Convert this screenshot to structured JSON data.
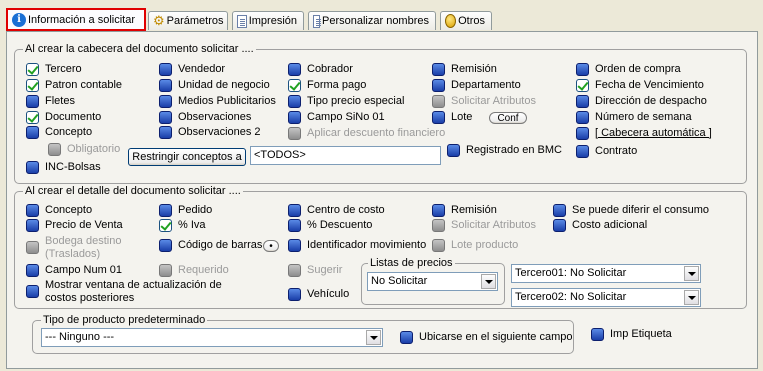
{
  "tabs": [
    {
      "label": "Información a solicitar",
      "icon": "info-icon",
      "active": true
    },
    {
      "label": "Parámetros",
      "icon": "gear-icon"
    },
    {
      "label": "Impresión",
      "icon": "document-icon"
    },
    {
      "label": "Personalizar nombres",
      "icon": "document-icon"
    },
    {
      "label": "Otros",
      "icon": "coin-icon"
    }
  ],
  "header_group": {
    "title": "Al crear la cabecera del documento solicitar ....",
    "items": {
      "tercero": {
        "label": "Tercero",
        "checked": true
      },
      "patron": {
        "label": "Patron contable",
        "checked": true
      },
      "fletes": {
        "label": "Fletes",
        "checked": false
      },
      "documento": {
        "label": "Documento",
        "checked": true
      },
      "concepto": {
        "label": "Concepto",
        "checked": false
      },
      "obligatorio": {
        "label": "Obligatorio",
        "checked": false,
        "disabled": true
      },
      "inc_bolsas": {
        "label": "INC-Bolsas",
        "checked": false
      },
      "vendedor": {
        "label": "Vendedor",
        "checked": false
      },
      "unidad": {
        "label": "Unidad de negocio",
        "checked": false
      },
      "medios": {
        "label": "Medios Publicitarios",
        "checked": false
      },
      "observaciones": {
        "label": "Observaciones",
        "checked": false
      },
      "observaciones2": {
        "label": "Observaciones 2",
        "checked": false
      },
      "cobrador": {
        "label": "Cobrador",
        "checked": false
      },
      "forma_pago": {
        "label": "Forma pago",
        "checked": true
      },
      "tipo_precio": {
        "label": "Tipo precio especial",
        "checked": false
      },
      "campo_sino": {
        "label": "Campo SiNo 01",
        "checked": false
      },
      "aplicar_desc": {
        "label": "Aplicar descuento financiero",
        "checked": false,
        "disabled": true
      },
      "remision": {
        "label": "Remisión",
        "checked": false
      },
      "departamento": {
        "label": "Departamento",
        "checked": false
      },
      "solicitar_atrib": {
        "label": "Solicitar Atributos",
        "checked": false,
        "disabled": true
      },
      "lote": {
        "label": "Lote",
        "checked": false
      },
      "registrado_bmc": {
        "label": "Registrado en BMC",
        "checked": false
      },
      "orden_compra": {
        "label": "Orden de compra",
        "checked": false
      },
      "fecha_venc": {
        "label": "Fecha de Vencimiento",
        "checked": true
      },
      "direccion": {
        "label": "Dirección de despacho",
        "checked": false
      },
      "num_semana": {
        "label": "Número de semana",
        "checked": false
      },
      "cabecera_auto": {
        "label": "[ Cabecera automática ]",
        "checked": false
      },
      "contrato": {
        "label": "Contrato",
        "checked": false
      }
    },
    "conf_button": "Conf",
    "restringir_button": "Restringir conceptos a",
    "conceptos_value": "<TODOS>"
  },
  "detail_group": {
    "title": "Al crear  el detalle del documento solicitar ....",
    "items": {
      "concepto": {
        "label": "Concepto",
        "checked": false
      },
      "precio_venta": {
        "label": "Precio de Venta",
        "checked": false
      },
      "bodega": {
        "label": "Bodega destino (Traslados)",
        "checked": false,
        "disabled": true
      },
      "campo_num": {
        "label": "Campo Num 01",
        "checked": false
      },
      "mostrar_ventana": {
        "label": "Mostrar ventana de actualización de costos posteriores",
        "checked": false
      },
      "pedido": {
        "label": "Pedido",
        "checked": false
      },
      "iva": {
        "label": "% Iva",
        "checked": true
      },
      "codigo_barras": {
        "label": "Código de barras",
        "checked": false
      },
      "requerido": {
        "label": "Requerido",
        "checked": false,
        "disabled": true
      },
      "centro_costo": {
        "label": "Centro de costo",
        "checked": false
      },
      "descuento": {
        "label": "% Descuento",
        "checked": false
      },
      "identificador": {
        "label": "Identificador movimiento",
        "checked": false
      },
      "sugerir": {
        "label": "Sugerir",
        "checked": false,
        "disabled": true
      },
      "vehiculo": {
        "label": "Vehículo",
        "checked": false
      },
      "remision": {
        "label": "Remisión",
        "checked": false
      },
      "solicitar_atrib": {
        "label": "Solicitar Atributos",
        "checked": false,
        "disabled": true
      },
      "lote_producto": {
        "label": "Lote producto",
        "checked": false,
        "disabled": true
      },
      "diferir": {
        "label": "Se puede diferir el consumo",
        "checked": false
      },
      "costo_adicional": {
        "label": "Costo adicional",
        "checked": false
      }
    },
    "listas_label": "Listas de precios",
    "listas_value": "No Solicitar",
    "tercero01": "Tercero01: No Solicitar",
    "tercero02": "Tercero02: No Solicitar"
  },
  "tipo_group": {
    "title": "Tipo de producto predeterminado",
    "select_value": "--- Ninguno ---",
    "ubicarse": {
      "label": "Ubicarse en el siguiente campo",
      "checked": false
    }
  },
  "imp_etiqueta": {
    "label": "Imp Etiqueta",
    "checked": false
  }
}
